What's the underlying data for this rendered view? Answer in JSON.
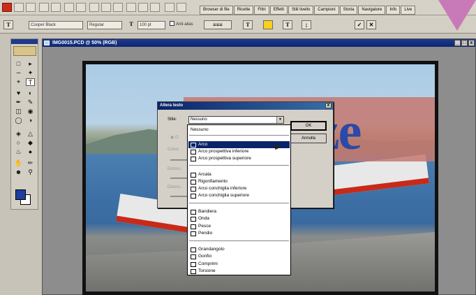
{
  "top_bar": {
    "palette_tabs": [
      "Browser di file",
      "Ricette",
      "Filtri",
      "Effetti",
      "Stili livello",
      "Campioni",
      "Storia",
      "Navigatore",
      "Info",
      "Live"
    ]
  },
  "options_bar": {
    "text_tool_icon": "T",
    "font_family": "Cooper Black",
    "font_style": "Regular",
    "font_size": "100 pt",
    "antialias_label": "Anti-alias",
    "commit_label": "✓",
    "cancel_label": "✕"
  },
  "document": {
    "title": "IMG0015.PCD @ 50% (RGB)",
    "text_layer": "Vacanze"
  },
  "dialog": {
    "title": "Altera testo",
    "style_label": "Stile:",
    "style_value": "Nessuno",
    "ok_label": "OK",
    "cancel_label": "Annulla",
    "orientation_prefix": "O",
    "bend_label": "Curva",
    "horizontal_distortion_label": "Distors.",
    "vertical_distortion_label": "Distors."
  },
  "dropdown": {
    "items": [
      {
        "label": "Nessuno",
        "icon": "none"
      },
      {
        "label": "Arco",
        "icon": "arc-icon"
      },
      {
        "label": "Arco prospettiva inferiore",
        "icon": "arc-lower-icon"
      },
      {
        "label": "Arco prospettiva superiore",
        "icon": "arc-upper-icon"
      },
      {
        "label": "Arcata",
        "icon": "arch-icon"
      },
      {
        "label": "Rigonfiamento",
        "icon": "bulge-icon"
      },
      {
        "label": "Arco conchiglia inferiore",
        "icon": "shell-lower-icon"
      },
      {
        "label": "Arco conchiglia superiore",
        "icon": "shell-upper-icon"
      },
      {
        "label": "Bandiera",
        "icon": "flag-icon"
      },
      {
        "label": "Onda",
        "icon": "wave-icon"
      },
      {
        "label": "Pesce",
        "icon": "fish-icon"
      },
      {
        "label": "Pendio",
        "icon": "rise-icon"
      },
      {
        "label": "Grandangolo",
        "icon": "fisheye-icon"
      },
      {
        "label": "Gonfio",
        "icon": "inflate-icon"
      },
      {
        "label": "Comprimi",
        "icon": "squeeze-icon"
      },
      {
        "label": "Torsione",
        "icon": "twist-icon"
      }
    ],
    "selected_index": 1
  },
  "colors": {
    "foreground": "#1f3f9e",
    "background": "#ffffff",
    "selection": "#0a246a",
    "title_bar": "#0c2570"
  }
}
